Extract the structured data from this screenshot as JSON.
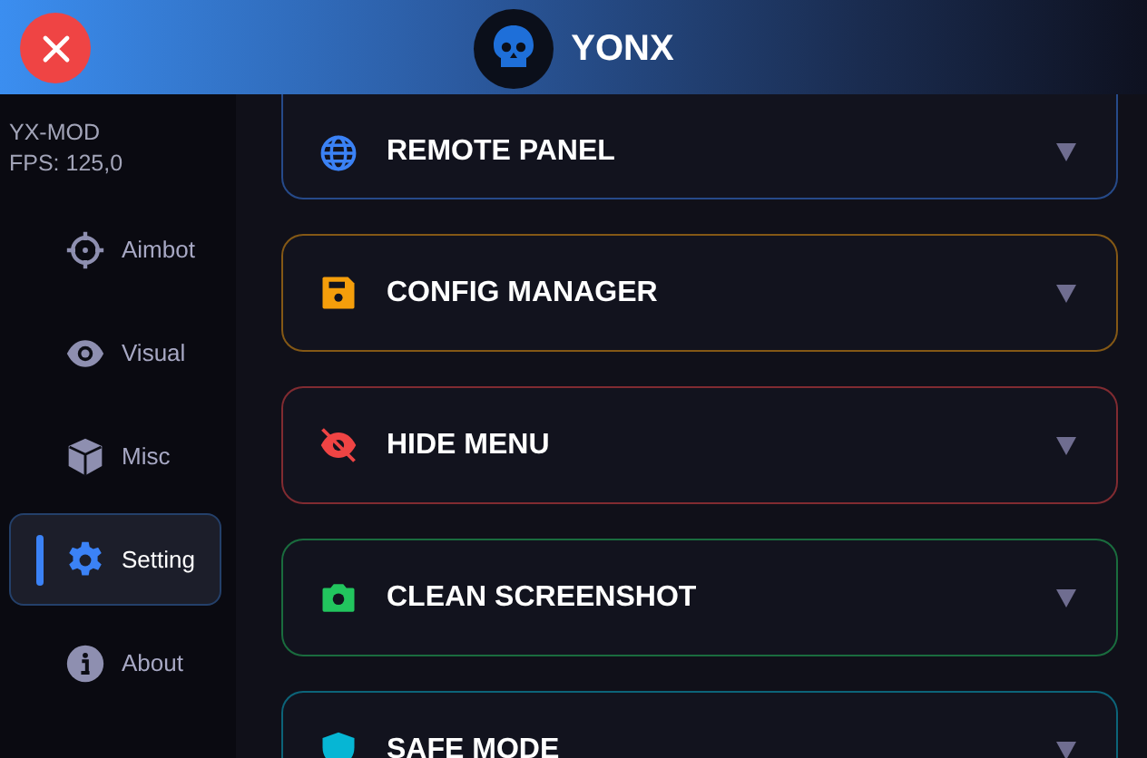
{
  "header": {
    "title": "YONX"
  },
  "sidebar": {
    "info": [
      "YX-MOD",
      "FPS: 125,0"
    ],
    "items": [
      {
        "label": "Aimbot",
        "selected": false
      },
      {
        "label": "Visual",
        "selected": false
      },
      {
        "label": "Misc",
        "selected": false
      },
      {
        "label": "Setting",
        "selected": true
      },
      {
        "label": "About",
        "selected": false
      }
    ]
  },
  "panels": [
    {
      "title": "REMOTE PANEL",
      "color": "#3b82f6"
    },
    {
      "title": "CONFIG MANAGER",
      "color": "#f59e0b"
    },
    {
      "title": "HIDE MENU",
      "color": "#ef4444"
    },
    {
      "title": "CLEAN SCREENSHOT",
      "color": "#22c55e"
    },
    {
      "title": "SAFE MODE",
      "color": "#06b6d4"
    }
  ]
}
